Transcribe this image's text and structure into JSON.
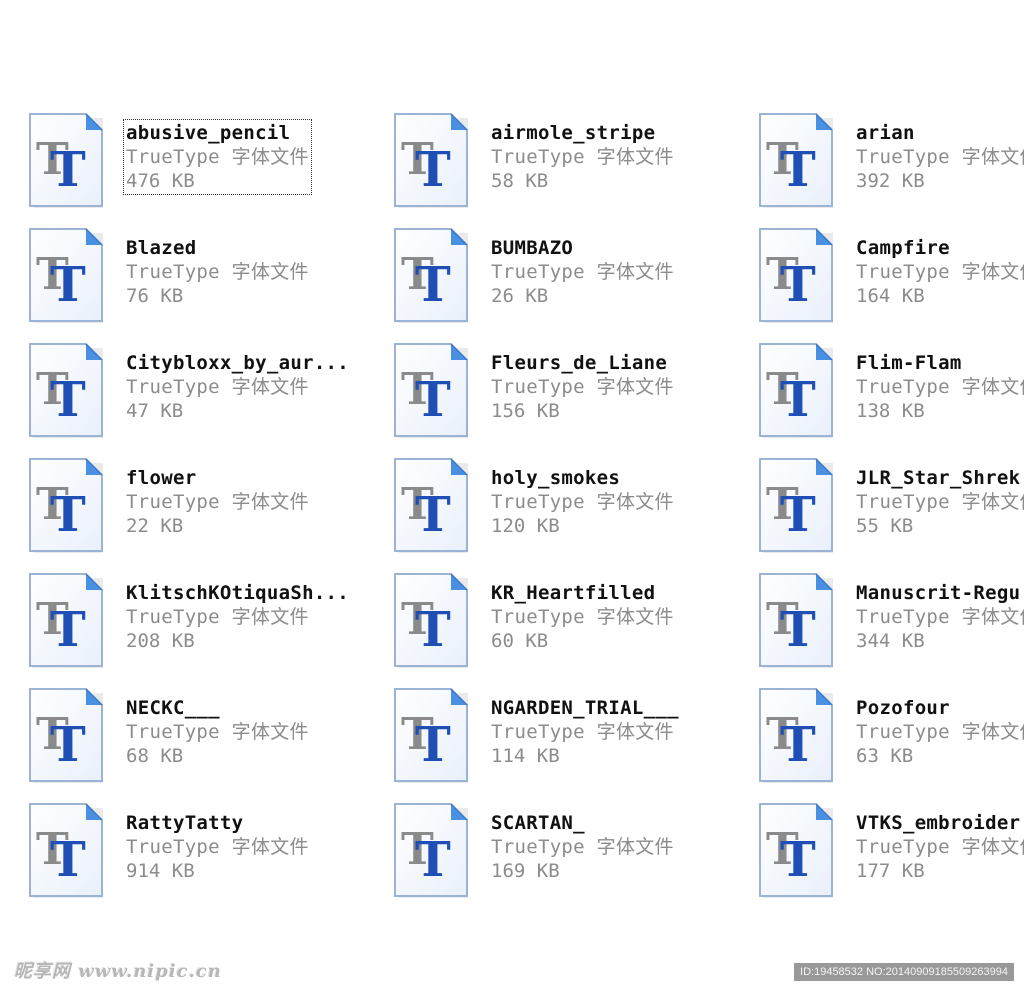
{
  "files": [
    {
      "name": "abusive_pencil",
      "type": "TrueType 字体文件",
      "size": "476 KB",
      "selected": true
    },
    {
      "name": "airmole_stripe",
      "type": "TrueType 字体文件",
      "size": "58 KB"
    },
    {
      "name": "arian",
      "type": "TrueType 字体文件",
      "size": "392 KB"
    },
    {
      "name": "Blazed",
      "type": "TrueType 字体文件",
      "size": "76 KB"
    },
    {
      "name": "BUMBAZO",
      "type": "TrueType 字体文件",
      "size": "26 KB"
    },
    {
      "name": "Campfire",
      "type": "TrueType 字体文件",
      "size": "164 KB"
    },
    {
      "name": "Citybloxx_by_aur...",
      "type": "TrueType 字体文件",
      "size": "47 KB"
    },
    {
      "name": "Fleurs_de_Liane",
      "type": "TrueType 字体文件",
      "size": "156 KB"
    },
    {
      "name": "Flim-Flam",
      "type": "TrueType 字体文件",
      "size": "138 KB"
    },
    {
      "name": "flower",
      "type": "TrueType 字体文件",
      "size": "22 KB"
    },
    {
      "name": "holy_smokes",
      "type": "TrueType 字体文件",
      "size": "120 KB"
    },
    {
      "name": "JLR_Star_Shrek",
      "type": "TrueType 字体文件",
      "size": "55 KB"
    },
    {
      "name": "KlitschKOtiquaSh...",
      "type": "TrueType 字体文件",
      "size": "208 KB"
    },
    {
      "name": "KR_Heartfilled",
      "type": "TrueType 字体文件",
      "size": "60 KB"
    },
    {
      "name": "Manuscrit-Regu",
      "type": "TrueType 字体文件",
      "size": "344 KB"
    },
    {
      "name": "NECKC___",
      "type": "TrueType 字体文件",
      "size": "68 KB"
    },
    {
      "name": "NGARDEN_TRIAL___",
      "type": "TrueType 字体文件",
      "size": "114 KB"
    },
    {
      "name": "Pozofour",
      "type": "TrueType 字体文件",
      "size": "63 KB"
    },
    {
      "name": "RattyTatty",
      "type": "TrueType 字体文件",
      "size": "914 KB"
    },
    {
      "name": "SCARTAN_",
      "type": "TrueType 字体文件",
      "size": "169 KB"
    },
    {
      "name": "VTKS_embroider",
      "type": "TrueType 字体文件",
      "size": "177 KB"
    }
  ],
  "icon": "truetype-font-file-icon",
  "colors": {
    "icon_glyph": "#1f4fb5",
    "icon_shadow": "#8a8a8a",
    "icon_page": "#e9f0fb",
    "icon_fold": "#4a90e2",
    "type_text": "#8c8c8c"
  },
  "watermark": {
    "left": "昵享网 www.nipic.cn",
    "right": "ID:19458532 NO:20140909185509263994"
  }
}
